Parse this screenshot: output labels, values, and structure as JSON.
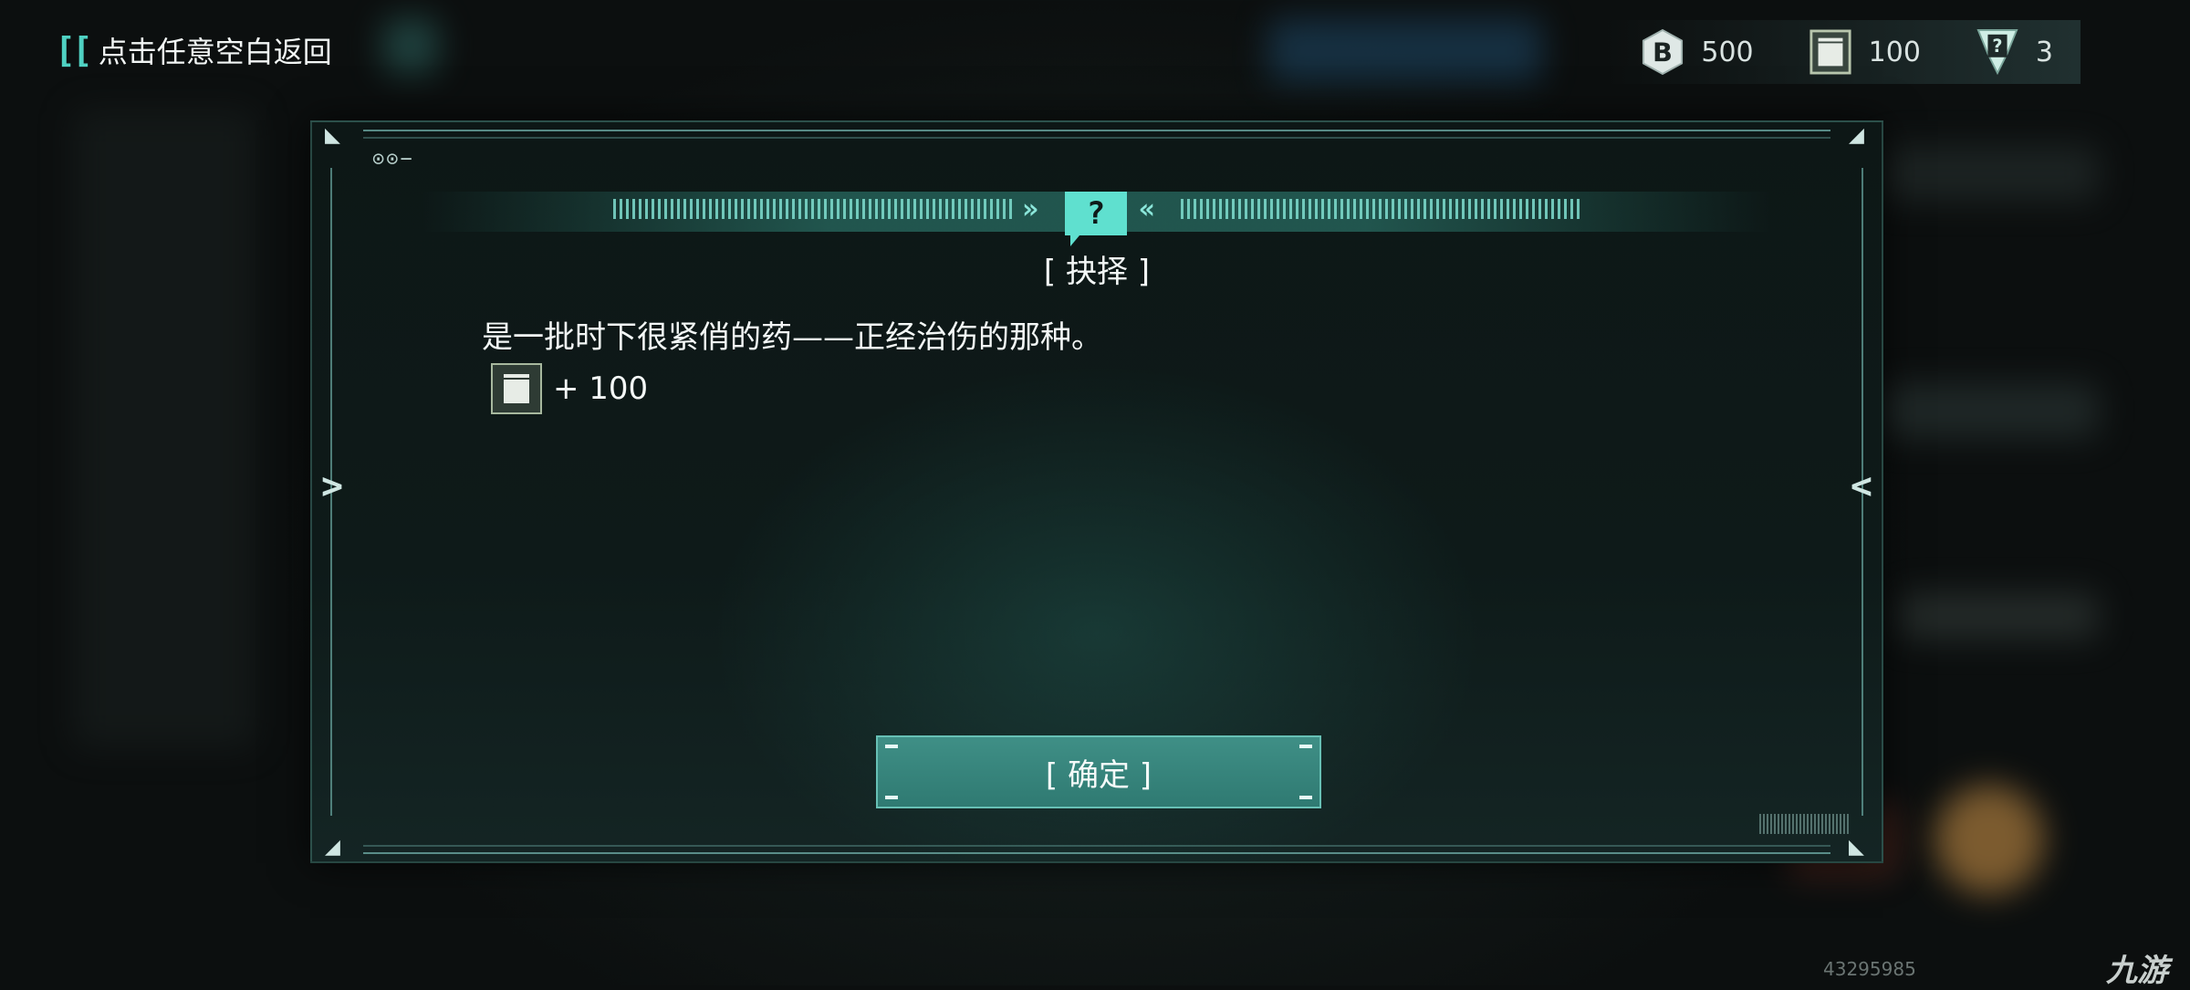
{
  "top_bar": {
    "back_hint": "点击任意空白返回",
    "back_icon": "double-bracket-icon",
    "currencies": [
      {
        "name": "coin-icon",
        "value": "500"
      },
      {
        "name": "ledger-icon",
        "value": "100"
      },
      {
        "name": "mystery-card-icon",
        "value": "3"
      }
    ]
  },
  "dialog": {
    "header_icon": "question-mark-icon",
    "title": "[ 抉择 ]",
    "message": "是一批时下很紧俏的药——正经治伤的那种。",
    "reward": {
      "icon": "ledger-icon",
      "text": "+ 100"
    },
    "confirm_label": "[ 确定 ]"
  },
  "watermark": {
    "id": "43295985",
    "logo": "九游"
  },
  "colors": {
    "accent": "#5fe0cf",
    "button": "#3a877e",
    "panel": "#0e1a19"
  }
}
